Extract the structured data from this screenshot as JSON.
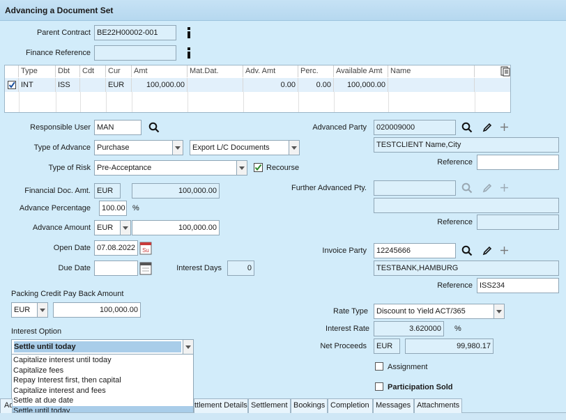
{
  "window": {
    "title": "Advancing a Document Set"
  },
  "parent_contract": {
    "label": "Parent Contract",
    "value": "BE22H00002-001"
  },
  "finance_reference": {
    "label": "Finance Reference",
    "value": ""
  },
  "table": {
    "columns": [
      "Type",
      "Dbt",
      "Cdt",
      "Cur",
      "Amt",
      "Mat.Dat.",
      "Adv. Amt",
      "Perc.",
      "Available Amt",
      "Name"
    ],
    "rows": [
      {
        "checked": true,
        "type": "INT",
        "dbt": "ISS",
        "cdt": "",
        "cur": "EUR",
        "amt": "100,000.00",
        "mat_dat": "",
        "adv_amt": "0.00",
        "perc": "0.00",
        "available_amt": "100,000.00",
        "name": ""
      }
    ]
  },
  "responsible_user": {
    "label": "Responsible User",
    "value": "MAN"
  },
  "type_of_advance": {
    "label": "Type of Advance",
    "value": "Purchase",
    "second_value": "Export L/C Documents"
  },
  "type_of_risk": {
    "label": "Type of Risk",
    "value": "Pre-Acceptance",
    "recourse_label": "Recourse",
    "recourse_checked": true
  },
  "financial_doc_amt": {
    "label": "Financial Doc. Amt.",
    "currency": "EUR",
    "value": "100,000.00"
  },
  "advance_percentage": {
    "label": "Advance Percentage",
    "value": "100.00",
    "unit": "%"
  },
  "advance_amount": {
    "label": "Advance Amount",
    "currency": "EUR",
    "value": "100,000.00"
  },
  "open_date": {
    "label": "Open Date",
    "value": "07.08.2022",
    "calendar_text": "Su"
  },
  "due_date": {
    "label": "Due Date",
    "value": ""
  },
  "interest_days": {
    "label": "Interest Days",
    "value": "0"
  },
  "packing_credit": {
    "label": "Packing Credit Pay Back Amount",
    "currency": "EUR",
    "value": "100,000.00"
  },
  "interest_option": {
    "label": "Interest Option",
    "value": "Settle until today",
    "options": [
      "Capitalize interest until today",
      "Capitalize fees",
      "Repay Interest first, then capital",
      "Capitalize interest and fees",
      "Settle at due date",
      "Settle until today"
    ],
    "selected_index": 5
  },
  "advanced_party": {
    "label": "Advanced Party",
    "value": "020009000",
    "name": "TESTCLIENT Name,City",
    "reference_label": "Reference",
    "reference": ""
  },
  "further_advanced_party": {
    "label": "Further Advanced Pty.",
    "value": "",
    "name": "",
    "reference_label": "Reference",
    "reference": ""
  },
  "invoice_party": {
    "label": "Invoice Party",
    "value": "12245666",
    "name": "TESTBANK,HAMBURG",
    "reference_label": "Reference",
    "reference": "ISS234"
  },
  "rate_type": {
    "label": "Rate Type",
    "value": "Discount to Yield ACT/365"
  },
  "interest_rate": {
    "label": "Interest Rate",
    "value": "3.620000",
    "unit": "%"
  },
  "net_proceeds": {
    "label": "Net Proceeds",
    "currency": "EUR",
    "value": "99,980.17"
  },
  "assignment": {
    "label": "Assignment",
    "checked": false
  },
  "participation_sold": {
    "label": "Participation Sold",
    "checked": false
  },
  "tabs": [
    "Ad",
    "ttlement Details",
    "Settlement",
    "Bookings",
    "Completion",
    "Messages",
    "Attachments"
  ],
  "colors": {
    "background": "#d2ecfa",
    "readonly_field": "#dcf0fb",
    "selected_option": "#a9cde9",
    "table_row": "#e2f0fb"
  },
  "icons": [
    "info-icon",
    "magnifier-icon",
    "pencil-icon",
    "plus-icon",
    "calendar-icon",
    "document-icon",
    "checkmark-icon"
  ]
}
